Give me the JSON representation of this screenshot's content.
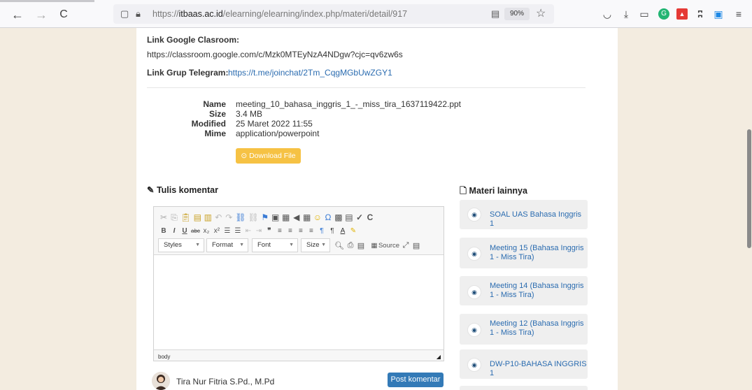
{
  "browser": {
    "back_icon": "←",
    "forward_icon": "→",
    "reload_icon": "C",
    "url_prefix": "https://",
    "url_domain": "itbaas.ac.id",
    "url_path": "/elearning/elearning/index.php/materi/detail/917",
    "zoom": "90%"
  },
  "page": {
    "classroom_label": "Link Google Clasroom:",
    "classroom_url": "https://classroom.google.com/c/Mzk0MTEyNzA4NDgw?cjc=qv6zw6s",
    "telegram_label": "Link Grup Telegram:",
    "telegram_url": "https://t.me/joinchat/2Tm_CqgMGbUwZGY1",
    "file": {
      "name_key": "Name",
      "name_val": "meeting_10_bahasa_inggris_1_-_miss_tira_1637119422.ppt",
      "size_key": "Size",
      "size_val": "3.4 MB",
      "modified_key": "Modified",
      "modified_val": "25 Maret 2022 11:55",
      "mime_key": "Mime",
      "mime_val": "application/powerpoint"
    },
    "download_label": "Download File",
    "comment_title": "Tulis komentar",
    "editor": {
      "combo_styles": "Styles",
      "combo_format": "Format",
      "combo_font": "Font",
      "combo_size": "Size",
      "source_label": "Source",
      "path_label": "body"
    },
    "user_name": "Tira Nur Fitria S.Pd., M.Pd",
    "post_label": "Post komentar",
    "materi_title": "Materi lainnya",
    "materi": [
      {
        "label": "SOAL UAS Bahasa Inggris 1"
      },
      {
        "label": "Meeting 15 (Bahasa Inggris 1 - Miss Tira)"
      },
      {
        "label": "Meeting 14 (Bahasa Inggris 1 - Miss Tira)"
      },
      {
        "label": "Meeting 12 (Bahasa Inggris 1 - Miss Tira)"
      },
      {
        "label": "DW-P10-BAHASA INGGRIS 1"
      }
    ]
  }
}
